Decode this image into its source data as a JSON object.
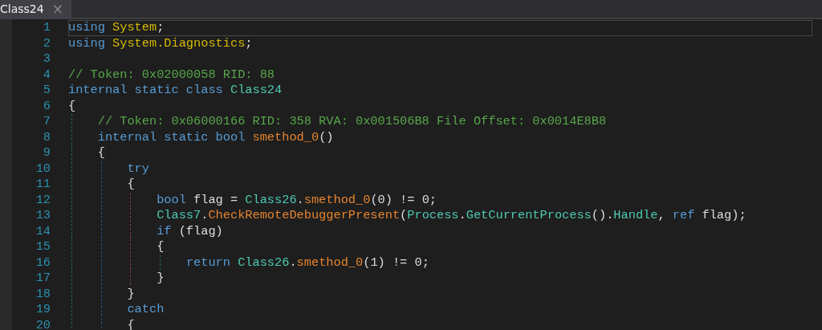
{
  "tabs": [
    {
      "label": "Class24",
      "close": "×",
      "selected": true
    }
  ],
  "lines": [
    {
      "number": "1",
      "selected": true,
      "tokens": [
        {
          "kind": "keyword",
          "text": "using "
        },
        {
          "kind": "namespace",
          "text": "System"
        },
        {
          "kind": "plain",
          "text": ";"
        }
      ]
    },
    {
      "number": "2",
      "selected": false,
      "tokens": [
        {
          "kind": "keyword",
          "text": "using "
        },
        {
          "kind": "namespace",
          "text": "System.Diagnostics"
        },
        {
          "kind": "plain",
          "text": ";"
        }
      ]
    },
    {
      "number": "3",
      "selected": false
    },
    {
      "number": "4",
      "selected": false,
      "tokens": [
        {
          "kind": "comment",
          "text": "// Token: 0x02000058 RID: 88"
        }
      ]
    },
    {
      "number": "5",
      "selected": false,
      "tokens": [
        {
          "kind": "keyword",
          "text": "internal static class "
        },
        {
          "kind": "type",
          "text": "Class24"
        }
      ]
    },
    {
      "number": "6",
      "selected": false,
      "tokens": [
        {
          "kind": "plain",
          "text": "{"
        }
      ]
    },
    {
      "number": "7",
      "selected": false,
      "tokens": [
        {
          "kind": "comment",
          "text": "    // Token: 0x06000166 RID: 358 RVA: 0x001506B8 File Offset: 0x0014E8B8"
        }
      ]
    },
    {
      "number": "8",
      "selected": false,
      "tokens": [
        {
          "kind": "keyword",
          "text": "    internal static bool "
        },
        {
          "kind": "method",
          "text": "smethod_0"
        },
        {
          "kind": "plain",
          "text": "()"
        }
      ]
    },
    {
      "number": "9",
      "selected": false,
      "tokens": [
        {
          "kind": "plain",
          "text": "    {"
        }
      ]
    },
    {
      "number": "10",
      "selected": false,
      "tokens": [
        {
          "kind": "keyword",
          "text": "        try"
        }
      ]
    },
    {
      "number": "11",
      "selected": false,
      "tokens": [
        {
          "kind": "plain",
          "text": "        {"
        }
      ]
    },
    {
      "number": "12",
      "selected": false,
      "tokens": [
        {
          "kind": "keyword",
          "text": "            bool"
        },
        {
          "kind": "plain",
          "text": " flag = "
        },
        {
          "kind": "type",
          "text": "Class26"
        },
        {
          "kind": "plain",
          "text": "."
        },
        {
          "kind": "method",
          "text": "smethod_0"
        },
        {
          "kind": "plain",
          "text": "(0) != 0;"
        }
      ]
    },
    {
      "number": "13",
      "selected": false,
      "tokens": [
        {
          "kind": "type",
          "text": "            Class7"
        },
        {
          "kind": "plain",
          "text": "."
        },
        {
          "kind": "method",
          "text": "CheckRemoteDebuggerPresent"
        },
        {
          "kind": "plain",
          "text": "("
        },
        {
          "kind": "type",
          "text": "Process"
        },
        {
          "kind": "plain",
          "text": "."
        },
        {
          "kind": "type",
          "text": "GetCurrentProcess"
        },
        {
          "kind": "plain",
          "text": "()."
        },
        {
          "kind": "type",
          "text": "Handle"
        },
        {
          "kind": "plain",
          "text": ", "
        },
        {
          "kind": "keyword",
          "text": "ref"
        },
        {
          "kind": "plain",
          "text": " flag);"
        }
      ]
    },
    {
      "number": "14",
      "selected": false,
      "tokens": [
        {
          "kind": "keyword",
          "text": "            if"
        },
        {
          "kind": "plain",
          "text": " (flag)"
        }
      ]
    },
    {
      "number": "15",
      "selected": false,
      "tokens": [
        {
          "kind": "plain",
          "text": "            {"
        }
      ]
    },
    {
      "number": "16",
      "selected": false,
      "tokens": [
        {
          "kind": "keyword",
          "text": "                return "
        },
        {
          "kind": "type",
          "text": "Class26"
        },
        {
          "kind": "plain",
          "text": "."
        },
        {
          "kind": "method",
          "text": "smethod_0"
        },
        {
          "kind": "plain",
          "text": "(1) != 0;"
        }
      ]
    },
    {
      "number": "17",
      "selected": false,
      "tokens": [
        {
          "kind": "plain",
          "text": "            }"
        }
      ]
    },
    {
      "number": "18",
      "selected": false,
      "tokens": [
        {
          "kind": "plain",
          "text": "        }"
        }
      ]
    },
    {
      "number": "19",
      "selected": false,
      "tokens": [
        {
          "kind": "keyword",
          "text": "        catch"
        }
      ]
    },
    {
      "number": "20",
      "selected": false,
      "tokens": [
        {
          "kind": "plain",
          "text": "        {"
        }
      ]
    }
  ]
}
